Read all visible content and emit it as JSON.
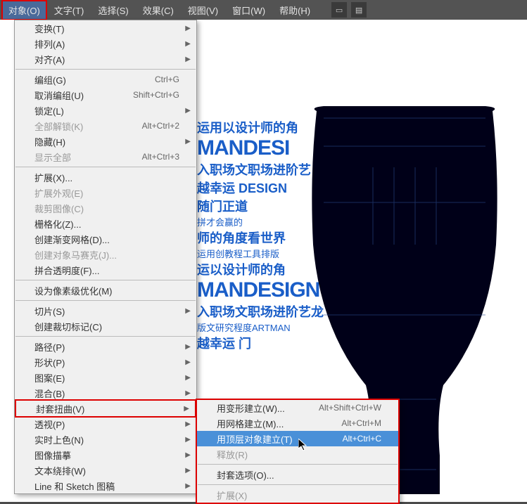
{
  "menubar": {
    "items": [
      "对象(O)",
      "文字(T)",
      "选择(S)",
      "效果(C)",
      "视图(V)",
      "窗口(W)",
      "帮助(H)"
    ]
  },
  "artwork": {
    "lines": [
      "运用以设计师的角",
      "MANDESI",
      "入职场文职场进阶艺",
      "越幸运 DESIGN",
      "随门正道",
      "拼才会赢的",
      "师的角度看世界",
      "运用创教程工具排版",
      "运以设计师的角",
      "MANDESIGN",
      "入职场文职场进阶艺龙",
      "版文研究程度ARTMAN",
      "越幸运 门"
    ]
  },
  "menu1": [
    {
      "label": "变换(T)",
      "arrow": true
    },
    {
      "label": "排列(A)",
      "arrow": true
    },
    {
      "label": "对齐(A)",
      "arrow": true
    },
    {
      "sep": true
    },
    {
      "label": "编组(G)",
      "shortcut": "Ctrl+G"
    },
    {
      "label": "取消编组(U)",
      "shortcut": "Shift+Ctrl+G"
    },
    {
      "label": "锁定(L)",
      "arrow": true
    },
    {
      "label": "全部解锁(K)",
      "shortcut": "Alt+Ctrl+2",
      "disabled": true
    },
    {
      "label": "隐藏(H)",
      "arrow": true
    },
    {
      "label": "显示全部",
      "shortcut": "Alt+Ctrl+3",
      "disabled": true
    },
    {
      "sep": true
    },
    {
      "label": "扩展(X)..."
    },
    {
      "label": "扩展外观(E)",
      "disabled": true
    },
    {
      "label": "裁剪图像(C)",
      "disabled": true
    },
    {
      "label": "栅格化(Z)..."
    },
    {
      "label": "创建渐变网格(D)..."
    },
    {
      "label": "创建对象马赛克(J)...",
      "disabled": true
    },
    {
      "label": "拼合透明度(F)..."
    },
    {
      "sep": true
    },
    {
      "label": "设为像素级优化(M)"
    },
    {
      "sep": true
    },
    {
      "label": "切片(S)",
      "arrow": true
    },
    {
      "label": "创建裁切标记(C)"
    },
    {
      "sep": true
    },
    {
      "label": "路径(P)",
      "arrow": true
    },
    {
      "label": "形状(P)",
      "arrow": true
    },
    {
      "label": "图案(E)",
      "arrow": true
    },
    {
      "label": "混合(B)",
      "arrow": true
    },
    {
      "label": "封套扭曲(V)",
      "arrow": true,
      "highlight": true
    },
    {
      "label": "透视(P)",
      "arrow": true
    },
    {
      "label": "实时上色(N)",
      "arrow": true
    },
    {
      "label": "图像描摹",
      "arrow": true
    },
    {
      "label": "文本绕排(W)",
      "arrow": true
    },
    {
      "label": "Line 和 Sketch 图稿",
      "arrow": true
    }
  ],
  "menu2": [
    {
      "label": "用变形建立(W)...",
      "shortcut": "Alt+Shift+Ctrl+W"
    },
    {
      "label": "用网格建立(M)...",
      "shortcut": "Alt+Ctrl+M"
    },
    {
      "label": "用顶层对象建立(T)",
      "shortcut": "Alt+Ctrl+C",
      "highlight": true
    },
    {
      "label": "释放(R)",
      "disabled": true
    },
    {
      "sep": true
    },
    {
      "label": "封套选项(O)..."
    },
    {
      "sep": true
    },
    {
      "label": "扩展(X)",
      "disabled": true
    }
  ]
}
